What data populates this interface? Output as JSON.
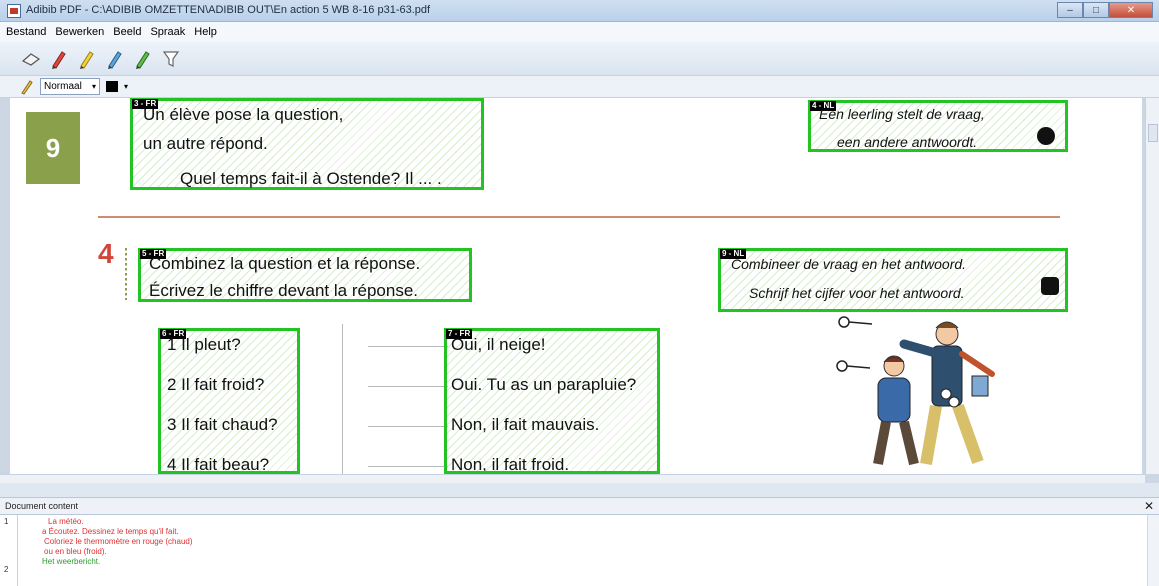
{
  "window": {
    "title": "Adibib PDF - C:\\ADIBIB OMZETTEN\\ADIBIB OUT\\En action 5 WB 8-16 p31-63.pdf",
    "controls": {
      "minimize": "–",
      "maximize": "□",
      "close": "✕"
    }
  },
  "menu": [
    "Bestand",
    "Bewerken",
    "Beeld",
    "Spraak",
    "Help"
  ],
  "toolbar": {
    "tools": [
      "eraser-icon",
      "red-marker-icon",
      "yellow-marker-icon",
      "blue-marker-icon",
      "green-marker-icon",
      "funnel-icon"
    ],
    "style_value": "Normaal",
    "style_arrow": "▾",
    "color_arrow": "▾",
    "color_value": "#000000"
  },
  "page": {
    "lesson_number": "9",
    "exercise_number": "4",
    "regions": [
      {
        "tag": "3 - FR",
        "lines": [
          "Un élève pose la question,",
          "un autre répond.",
          "Quel temps fait-il à Ostende? Il ... ."
        ]
      },
      {
        "tag": "4 - NL",
        "lines": [
          "Een leerling stelt de vraag,",
          "een andere antwoordt."
        ]
      },
      {
        "tag": "5 - FR",
        "lines": [
          "Combinez la question et la réponse.",
          "Écrivez le chiffre devant la réponse."
        ]
      },
      {
        "tag": "9 - NL",
        "lines": [
          "Combineer de vraag en het antwoord.",
          "Schrijf het cijfer voor het antwoord."
        ]
      },
      {
        "tag": "6 - FR",
        "lines": [
          "1 Il pleut?",
          "2 Il fait froid?",
          "3 Il fait chaud?",
          "4 Il fait beau?"
        ]
      },
      {
        "tag": "7 - FR",
        "lines": [
          "Oui, il neige!",
          "Oui. Tu as un parapluie?",
          "Non, il fait mauvais.",
          "Non, il fait froid."
        ]
      }
    ]
  },
  "panel": {
    "title": "Document content",
    "close": "✕",
    "line_numbers": [
      "1",
      "2"
    ],
    "lines": [
      {
        "text": "La météo.",
        "color": "red"
      },
      {
        "text": "a Écoutez. Dessinez le temps qu'il fait.",
        "color": "red"
      },
      {
        "text": "Coloriez le thermomètre en rouge (chaud)",
        "color": "red"
      },
      {
        "text": "ou en bleu (froid).",
        "color": "red"
      },
      {
        "text": "Het weerbericht.",
        "color": "green"
      }
    ]
  }
}
